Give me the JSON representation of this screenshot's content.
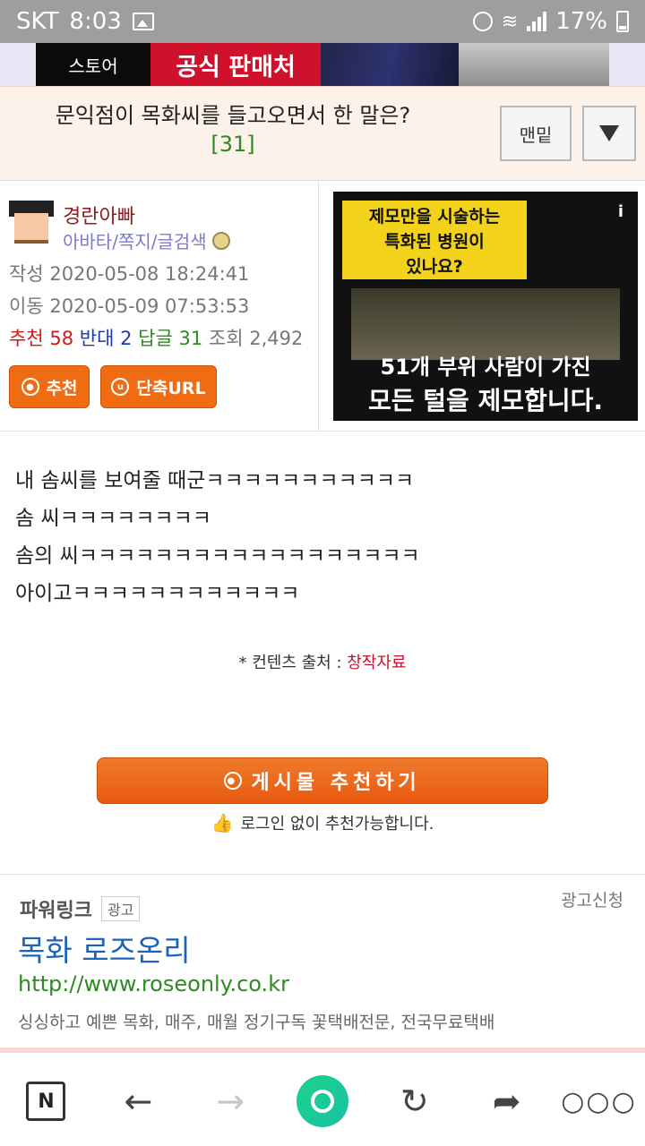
{
  "status_bar": {
    "carrier": "SKT",
    "time": "8:03",
    "battery": "17%"
  },
  "banner": {
    "store_text": "스토어",
    "official_text": "공식 판매처"
  },
  "title": {
    "text": "문익점이 목화씨를 들고오면서 한 말은?",
    "comment_count": "[31]",
    "bottom_button": "맨밑"
  },
  "author": {
    "nickname": "경란아빠",
    "links": "아바타/쪽지/글검색",
    "created_label": "작성",
    "created": "2020-05-08 18:24:41",
    "moved_label": "이동",
    "moved": "2020-05-09 07:53:53",
    "rec_label": "추천",
    "rec_count": "58",
    "opp_label": "반대",
    "opp_count": "2",
    "reply_label": "답글",
    "reply_count": "31",
    "view_label": "조회",
    "view_count": "2,492",
    "rec_button": "추천",
    "url_button": "단축URL"
  },
  "ad": {
    "line_a": "제모만을 시술하는",
    "line_b": "특화된 병원이",
    "line_c": "있나요?",
    "line_d": "51개 부위 사람이 가진",
    "line_e": "모든 털을 제모합니다.",
    "info": "i"
  },
  "content": {
    "lines": [
      "내 솜씨를 보여줄 때군ㅋㅋㅋㅋㅋㅋㅋㅋㅋㅋㅋ",
      "솜 씨ㅋㅋㅋㅋㅋㅋㅋㅋ",
      "솜의 씨ㅋㅋㅋㅋㅋㅋㅋㅋㅋㅋㅋㅋㅋㅋㅋㅋㅋㅋ",
      "아이고ㅋㅋㅋㅋㅋㅋㅋㅋㅋㅋㅋㅋ"
    ],
    "source_label": "* 컨텐츠 출처 : ",
    "source_value": "창작자료"
  },
  "recommend": {
    "button": "게시물 추천하기",
    "note": "로그인 없이 추천가능합니다."
  },
  "powerlink": {
    "title": "파워링크",
    "ad_tag": "광고",
    "apply": "광고신청",
    "headline": "목화 로즈온리",
    "url": "http://www.roseonly.co.kr",
    "description": "싱싱하고 예쁜 목화, 매주, 매월 정기구독 꽃택배전문, 전국무료택배"
  },
  "bottom_nav": {
    "home_letter": "N"
  }
}
